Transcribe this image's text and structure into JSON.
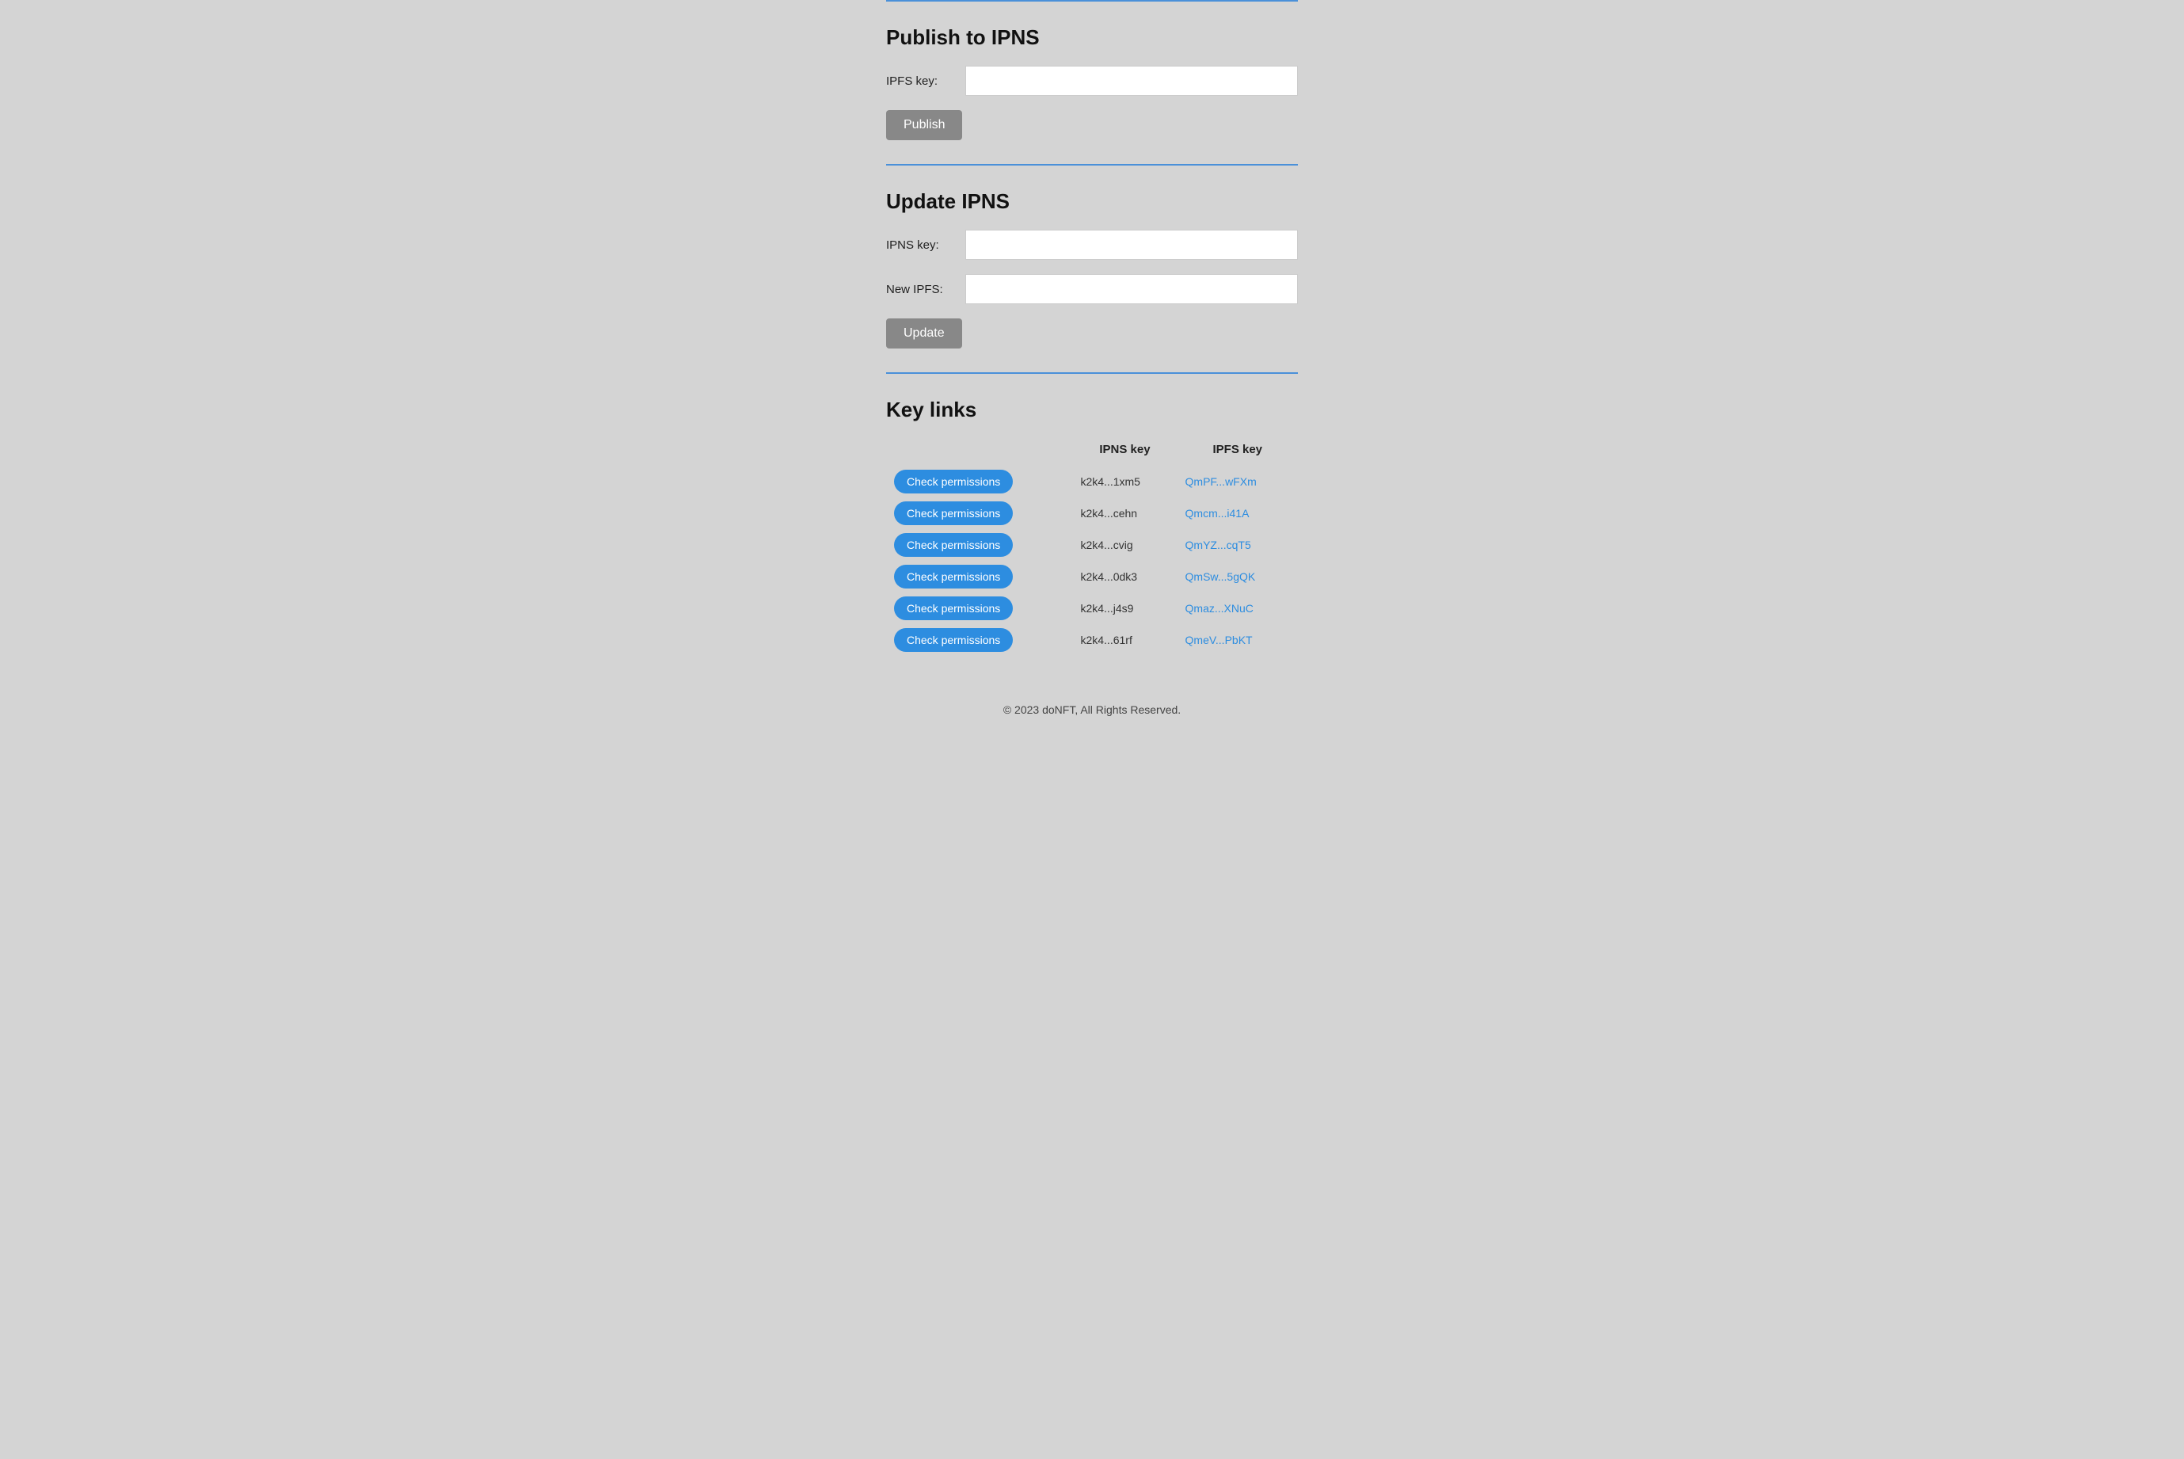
{
  "publish_section": {
    "title": "Publish to IPNS",
    "ipfs_key_label": "IPFS key:",
    "ipfs_key_placeholder": "",
    "publish_button": "Publish"
  },
  "update_section": {
    "title": "Update IPNS",
    "ipns_key_label": "IPNS key:",
    "ipns_key_placeholder": "",
    "new_ipfs_label": "New IPFS:",
    "new_ipfs_placeholder": "",
    "update_button": "Update"
  },
  "key_links_section": {
    "title": "Key links",
    "col_ipns": "IPNS key",
    "col_ipfs": "IPFS key",
    "rows": [
      {
        "check_btn": "Check permissions",
        "ipns_key": "k2k4...1xm5",
        "ipfs_key": "QmPF...wFXm"
      },
      {
        "check_btn": "Check permissions",
        "ipns_key": "k2k4...cehn",
        "ipfs_key": "Qmcm...i41A"
      },
      {
        "check_btn": "Check permissions",
        "ipns_key": "k2k4...cvig",
        "ipfs_key": "QmYZ...cqT5"
      },
      {
        "check_btn": "Check permissions",
        "ipns_key": "k2k4...0dk3",
        "ipfs_key": "QmSw...5gQK"
      },
      {
        "check_btn": "Check permissions",
        "ipns_key": "k2k4...j4s9",
        "ipfs_key": "Qmaz...XNuC"
      },
      {
        "check_btn": "Check permissions",
        "ipns_key": "k2k4...61rf",
        "ipfs_key": "QmeV...PbKT"
      }
    ]
  },
  "footer": {
    "text": "© 2023 doNFT, All Rights Reserved."
  }
}
